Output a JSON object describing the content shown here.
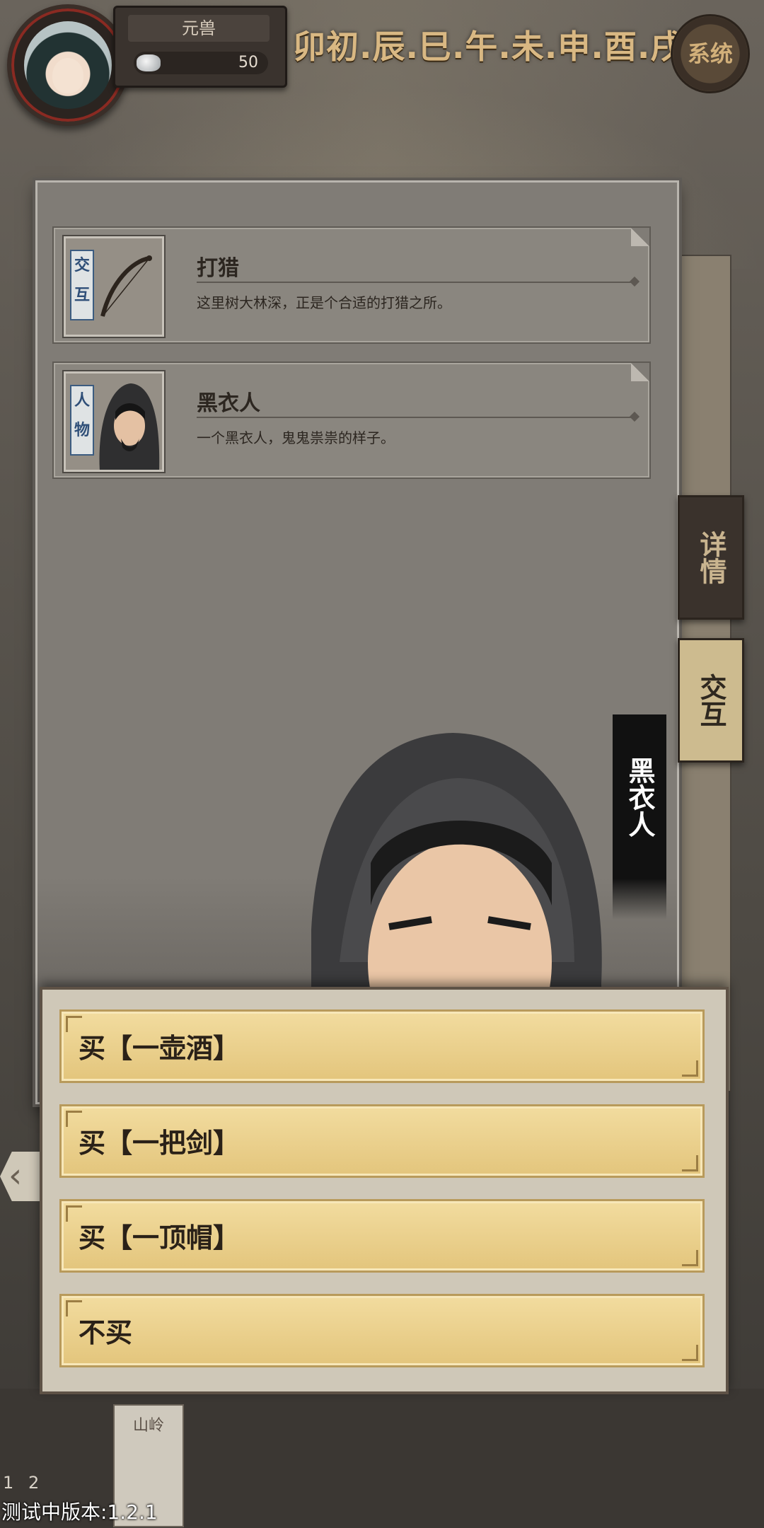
{
  "header": {
    "player_name": "元兽",
    "silver_amount": "50",
    "time_display": "卯初.辰.巳.午.未.申.酉.戌",
    "system_button": "系统"
  },
  "events": [
    {
      "tag": "交互",
      "title": "打猎",
      "description": "这里树大林深，正是个合适的打猎之所。"
    },
    {
      "tag": "人物",
      "title": "黑衣人",
      "description": "一个黑衣人，鬼鬼祟祟的样子。"
    }
  ],
  "side_tabs": {
    "detail": "详情",
    "interact": "交互"
  },
  "npc": {
    "name": "黑衣人"
  },
  "dialog_options": [
    "买【一壶酒】",
    "买【一把剑】",
    "买【一顶帽】",
    "不买"
  ],
  "footer": {
    "location_card": "山岭",
    "count_a": "1",
    "count_b": "2",
    "version_text": "测试中版本:1.2.1"
  },
  "colors": {
    "panel": "#807c76",
    "option_gold": "#e9cf8c",
    "tab_active": "#cdbb8f"
  }
}
